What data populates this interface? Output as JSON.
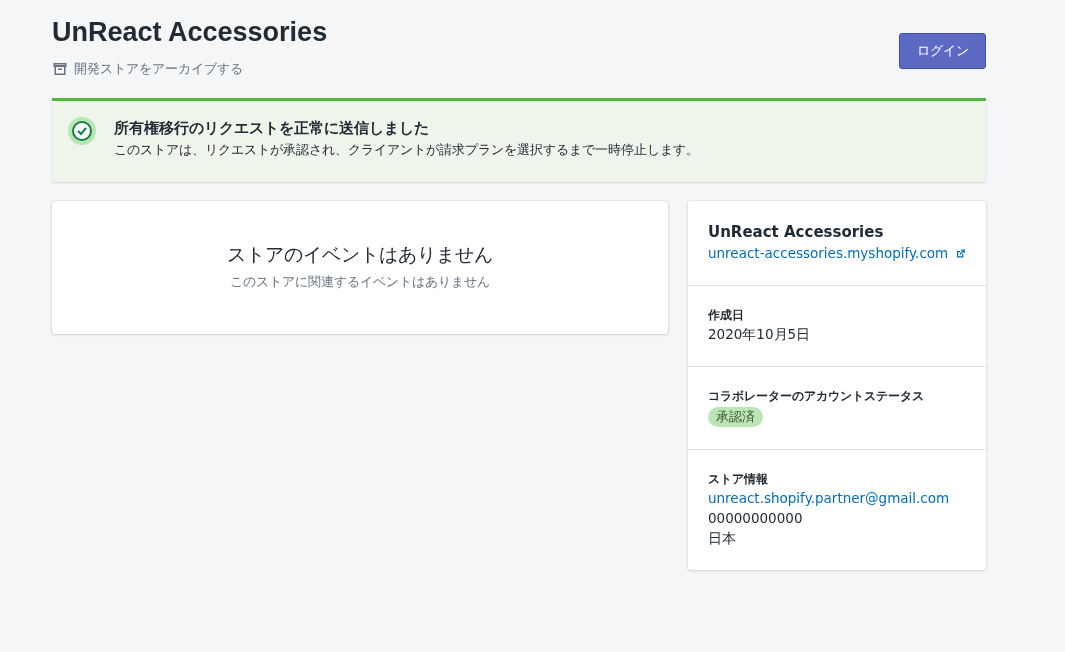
{
  "header": {
    "title": "UnReact Accessories",
    "archive_action": "開発ストアをアーカイブする",
    "login_button": "ログイン"
  },
  "banner": {
    "title": "所有権移行のリクエストを正常に送信しました",
    "message": "このストアは、リクエストが承認され、クライアントが請求プランを選択するまで一時停止します。"
  },
  "events": {
    "title": "ストアのイベントはありません",
    "subtitle": "このストアに関連するイベントはありません"
  },
  "store_card": {
    "sections": [
      {
        "kind": "header",
        "title": "UnReact Accessories",
        "link": "unreact-accessories.myshopify.com"
      },
      {
        "kind": "field",
        "label": "作成日",
        "items": [
          {
            "kind": "text",
            "text": "2020年10月5日"
          }
        ]
      },
      {
        "kind": "field",
        "label": "コラボレーターのアカウントステータス",
        "items": [
          {
            "kind": "badge",
            "text": "承認済"
          }
        ]
      },
      {
        "kind": "field",
        "label": "ストア情報",
        "items": [
          {
            "kind": "link",
            "text": "unreact.shopify.partner@gmail.com"
          },
          {
            "kind": "text",
            "text": "00000000000"
          },
          {
            "kind": "text",
            "text": "日本"
          }
        ]
      }
    ]
  }
}
